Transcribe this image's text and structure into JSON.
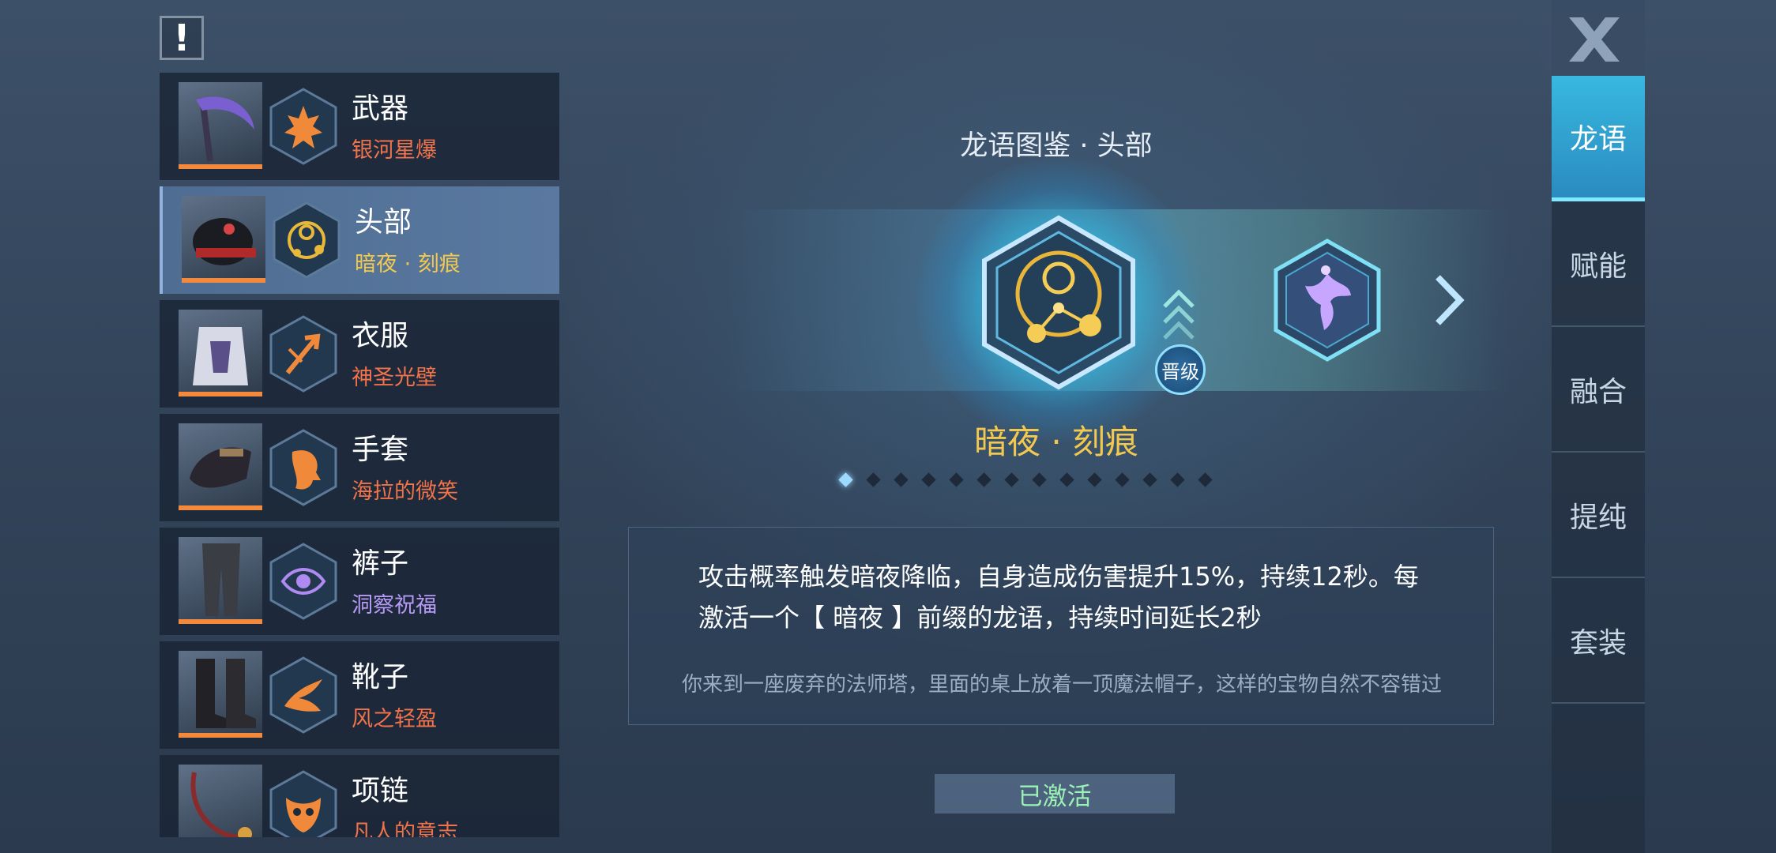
{
  "info_button": {
    "label": "!"
  },
  "slots": [
    {
      "name": "武器",
      "sub": "银河星爆",
      "sub_color": "#f2734a",
      "icon": "flame-burst-icon",
      "rune_color": "#f08a3a",
      "item": "scythe-weapon"
    },
    {
      "name": "头部",
      "sub": "暗夜 · 刻痕",
      "sub_color": "#f3c84e",
      "icon": "constellation-icon",
      "rune_color": "#e8b83a",
      "item": "helmet",
      "selected": true
    },
    {
      "name": "衣服",
      "sub": "神圣光壁",
      "sub_color": "#f2734a",
      "icon": "broken-arrow-icon",
      "rune_color": "#f08a3a",
      "item": "armor"
    },
    {
      "name": "手套",
      "sub": "海拉的微笑",
      "sub_color": "#f2734a",
      "icon": "face-profile-icon",
      "rune_color": "#f08a3a",
      "item": "gauntlet"
    },
    {
      "name": "裤子",
      "sub": "洞察祝福",
      "sub_color": "#b69af5",
      "icon": "eye-icon",
      "rune_color": "#b08af0",
      "item": "pants"
    },
    {
      "name": "靴子",
      "sub": "风之轻盈",
      "sub_color": "#f2734a",
      "icon": "wind-swirl-icon",
      "rune_color": "#f08a3a",
      "item": "boots"
    },
    {
      "name": "项链",
      "sub": "凡人的意志",
      "sub_color": "#f2734a",
      "icon": "mask-icon",
      "rune_color": "#f08a3a",
      "item": "necklace"
    }
  ],
  "center": {
    "title": "龙语图鉴 · 头部",
    "skill_name": "暗夜 · 刻痕",
    "upgrade_label": "晋级",
    "page_count": 14,
    "active_page": 1,
    "description": "攻击概率触发暗夜降临，自身造成伤害提升15%，持续12秒。每激活一个【 暗夜 】前缀的龙语，持续时间延长2秒",
    "flavor": "你来到一座废弃的法师塔，里面的桌上放着一顶魔法帽子，这样的宝物自然不容错过",
    "status_button": "已激活"
  },
  "tabs": [
    {
      "label": "龙语",
      "active": true
    },
    {
      "label": "赋能"
    },
    {
      "label": "融合"
    },
    {
      "label": "提纯"
    },
    {
      "label": "套装"
    }
  ],
  "colors": {
    "accent": "#f3c84e",
    "orange": "#f2734a",
    "active_tab": "#38b8e0",
    "activated_text": "#9cf2b4"
  }
}
